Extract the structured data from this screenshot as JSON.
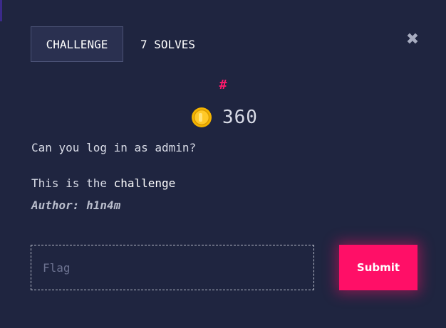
{
  "tabs": {
    "challenge_label": "CHALLENGE",
    "solves_label": "7 SOLVES"
  },
  "close_icon": "close-icon",
  "category_icon": "hash-icon",
  "points": {
    "value": "360",
    "icon": "coin-icon"
  },
  "description": "Can you log in as admin?",
  "body": {
    "prefix": "This is the ",
    "link_text": "challenge"
  },
  "author": "Author: h1n4m",
  "flag_input": {
    "placeholder": "Flag",
    "value": ""
  },
  "submit_label": "Submit",
  "colors": {
    "background": "#1f2540",
    "accent": "#ff0f67",
    "coin": "#f4b400"
  }
}
